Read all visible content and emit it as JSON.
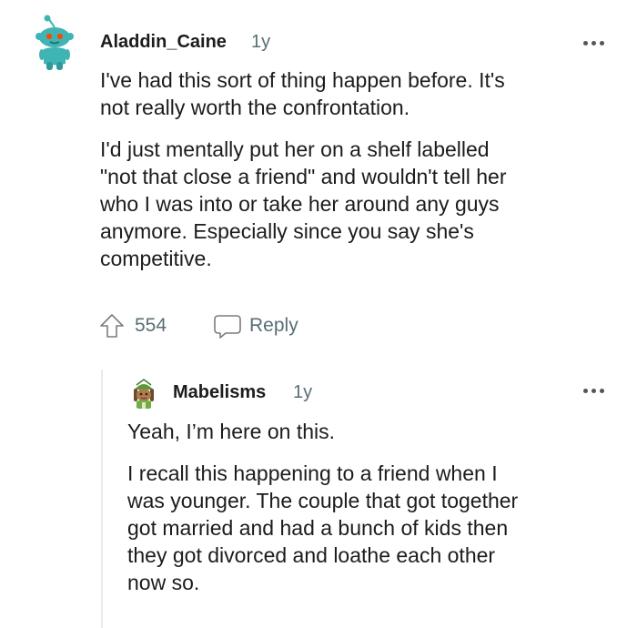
{
  "comment1": {
    "author": "Aladdin_Caine",
    "age": "1y",
    "avatar_icon": "snoo-avatar-teal",
    "paragraphs": [
      "I've had this sort of thing happen before. It's\nnot really worth the confrontation.",
      "I'd just mentally put her on a shelf labelled\n\"not that close a friend\" and wouldn't tell her\nwho I was into or take her around any guys\nanymore. Especially since you say she's\ncompetitive."
    ],
    "votes": "554",
    "reply_label": "Reply",
    "more_icon": "ellipsis-icon"
  },
  "comment2": {
    "author": "Mabelisms",
    "age": "1y",
    "avatar_icon": "snoo-avatar-green-hat",
    "paragraphs": [
      "Yeah, I’m here on this.",
      "I recall this happening to a friend when I\nwas younger. The couple that got together\ngot married and had a bunch of kids then\nthey got divorced and loathe each other\nnow so."
    ],
    "more_icon": "ellipsis-icon"
  },
  "colors": {
    "text": "#1c1c1c",
    "meta": "#576f76",
    "thread_line": "#e5ebee",
    "avatar_teal": "#3fb4b4"
  }
}
